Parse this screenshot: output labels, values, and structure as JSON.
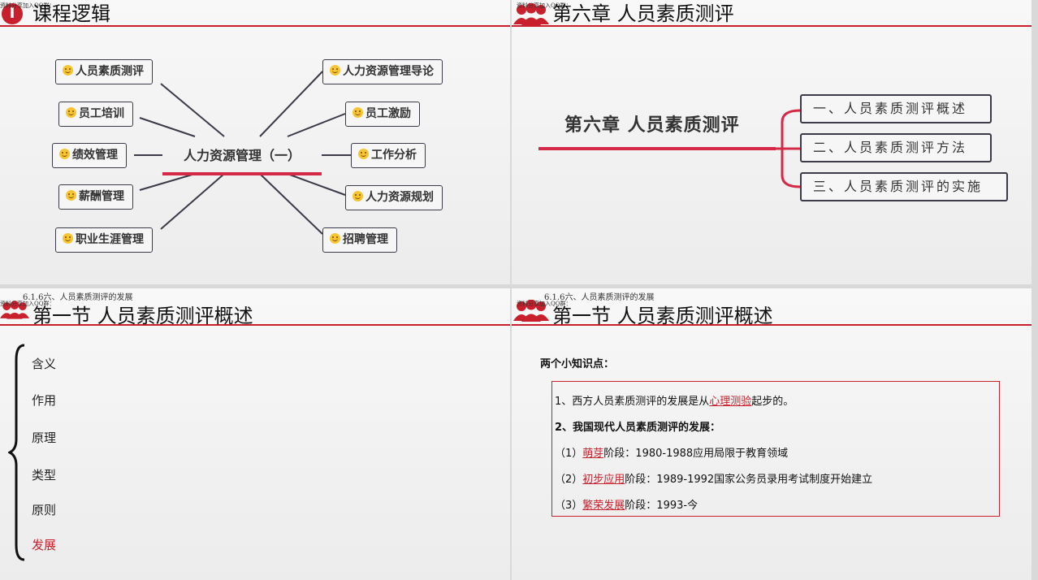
{
  "slide1": {
    "tiny_note": "资料分享加入QQ群：",
    "logo_char": "I",
    "title": "课程逻辑",
    "center": "人力资源管理（一）",
    "nodes_left": [
      "人员素质测评",
      "员工培训",
      "绩效管理",
      "薪酬管理",
      "职业生涯管理"
    ],
    "nodes_right": [
      "人力资源管理导论",
      "员工激励",
      "工作分析",
      "人力资源规划",
      "招聘管理"
    ],
    "icon": "smiley-face-icon"
  },
  "slide2": {
    "tiny_note": "资料分享加入QQ群：",
    "title": "第六章  人员素质测评",
    "main": "第六章 人员素质测评",
    "items": [
      "一、人员素质测评概述",
      "二、人员素质测评方法",
      "三、人员素质测评的实施"
    ]
  },
  "slide3": {
    "tiny_note": "6.1.6六、人员素质测评的发展",
    "tiny_note2": "资料分享加入QQ群：",
    "title": "第一节  人员素质测评概述",
    "items": [
      "含义",
      "作用",
      "原理",
      "类型",
      "原则",
      "发展"
    ]
  },
  "slide4": {
    "tiny_note": "6.1.6六、人员素质测评的发展",
    "tiny_note2": "资料分享加入QQ群：",
    "title": "第一节  人员素质测评概述",
    "heading": "两个小知识点：",
    "line1_a": "1、西方人员素质测评的发展是从",
    "line1_link": "心理测验",
    "line1_b": "起步的。",
    "line2": "2、我国现代人员素质测评的发展：",
    "line3_a": "（1）",
    "line3_link": "萌芽",
    "line3_b": "阶段：1980-1988应用局限于教育领域",
    "line4_a": "（2）",
    "line4_link": "初步应用",
    "line4_b": "阶段：1989-1992国家公务员录用考试制度开始建立",
    "line5_a": "（3）",
    "line5_link": "繁荣发展",
    "line5_b": "阶段：1993-今"
  },
  "colors": {
    "accent": "#c8202c",
    "underline": "#d42a48"
  }
}
